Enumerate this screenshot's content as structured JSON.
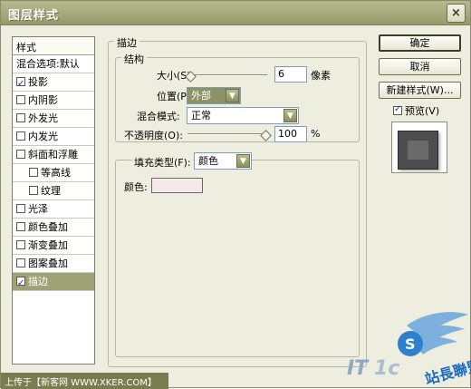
{
  "window": {
    "title": "图层样式"
  },
  "left": {
    "header": "样式",
    "items": [
      {
        "label": "混合选项:默认",
        "checkbox": false,
        "checked": false
      },
      {
        "label": "投影",
        "checkbox": true,
        "checked": true
      },
      {
        "label": "内阴影",
        "checkbox": true,
        "checked": false
      },
      {
        "label": "外发光",
        "checkbox": true,
        "checked": false
      },
      {
        "label": "内发光",
        "checkbox": true,
        "checked": false
      },
      {
        "label": "斜面和浮雕",
        "checkbox": true,
        "checked": false
      },
      {
        "label": "等高线",
        "checkbox": true,
        "checked": false
      },
      {
        "label": "纹理",
        "checkbox": true,
        "checked": false
      },
      {
        "label": "光泽",
        "checkbox": true,
        "checked": false
      },
      {
        "label": "颜色叠加",
        "checkbox": true,
        "checked": false
      },
      {
        "label": "渐变叠加",
        "checkbox": true,
        "checked": false
      },
      {
        "label": "图案叠加",
        "checkbox": true,
        "checked": false
      },
      {
        "label": "描边",
        "checkbox": true,
        "checked": true
      }
    ]
  },
  "stroke": {
    "group_label": "描边",
    "structure_label": "结构",
    "size_label": "大小(S):",
    "size_value": "6",
    "size_unit": "像素",
    "position_label": "位置(P):",
    "position_value": "外部",
    "blend_label": "混合模式:",
    "blend_value": "正常",
    "opacity_label": "不透明度(O):",
    "opacity_value": "100",
    "opacity_unit": "%",
    "fill_type_label": "填充类型(F):",
    "fill_type_value": "颜色",
    "color_label": "颜色:",
    "color_value": "#f6e9e9"
  },
  "buttons": {
    "ok": "确定",
    "cancel": "取消",
    "new_style": "新建样式(W)...",
    "preview": "预览(V)"
  },
  "footer": {
    "upload_note": "上传于【新客网 WWW.XKER.COM】"
  },
  "watermark": {
    "text": "站長聯盟"
  },
  "colors": {
    "selected_bg": "#9fa274",
    "titlebar": "#a4a878",
    "dialog_bg": "#eeeee0"
  }
}
